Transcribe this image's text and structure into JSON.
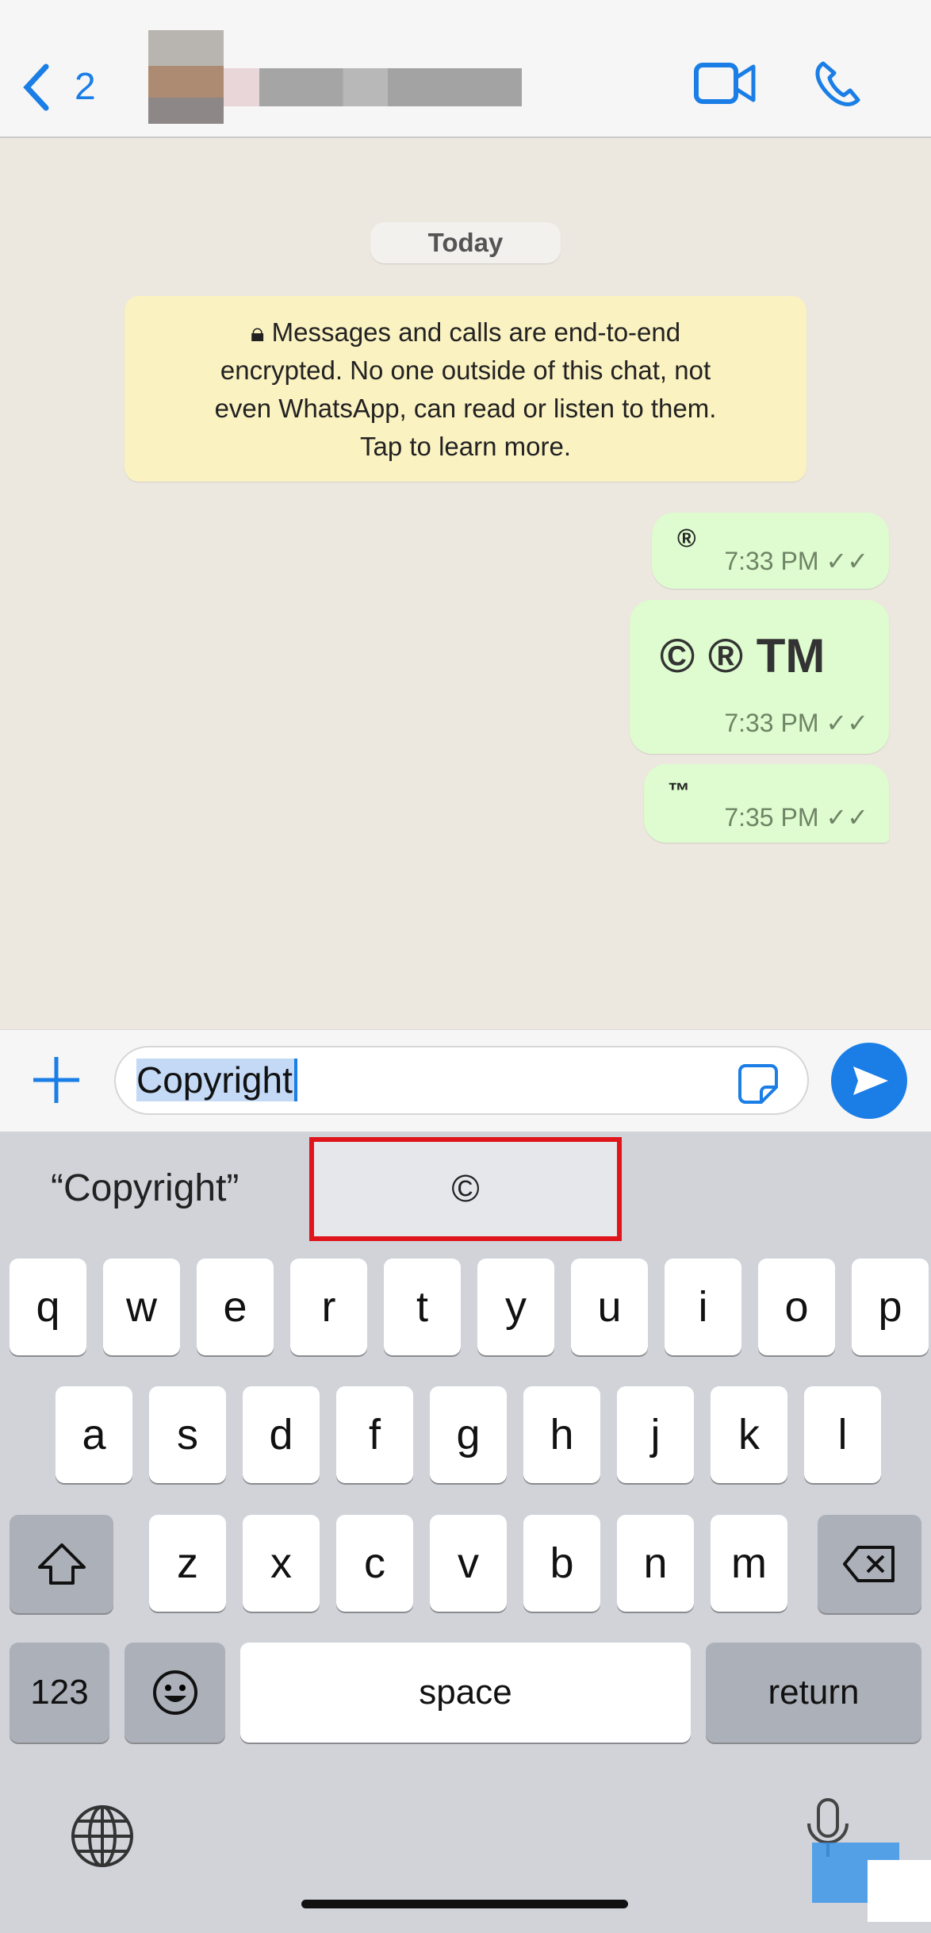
{
  "header": {
    "back_count": "2",
    "contact_name_blurred": true
  },
  "chat": {
    "date_label": "Today",
    "encryption_notice": [
      "Messages and calls are end-to-end",
      "encrypted. No one outside of this chat, not",
      "even WhatsApp, can read or listen to them.",
      "Tap to learn more."
    ],
    "messages": [
      {
        "text": "®",
        "time": "7:33 PM",
        "status": "read"
      },
      {
        "text": "© ® TM",
        "time": "7:33 PM",
        "status": "read"
      },
      {
        "text": "™",
        "time": "7:35 PM",
        "status": "read"
      }
    ]
  },
  "composer": {
    "value": "Copyright"
  },
  "keyboard": {
    "suggestions": [
      "“Copyright”",
      "©"
    ],
    "row1": [
      "q",
      "w",
      "e",
      "r",
      "t",
      "y",
      "u",
      "i",
      "o",
      "p"
    ],
    "row2": [
      "a",
      "s",
      "d",
      "f",
      "g",
      "h",
      "j",
      "k",
      "l"
    ],
    "row3": [
      "z",
      "x",
      "c",
      "v",
      "b",
      "n",
      "m"
    ],
    "numbers_label": "123",
    "space_label": "space",
    "return_label": "return"
  },
  "colors": {
    "accent": "#1a7ee6",
    "bubble": "#defccf",
    "highlight": "#e0141b"
  }
}
